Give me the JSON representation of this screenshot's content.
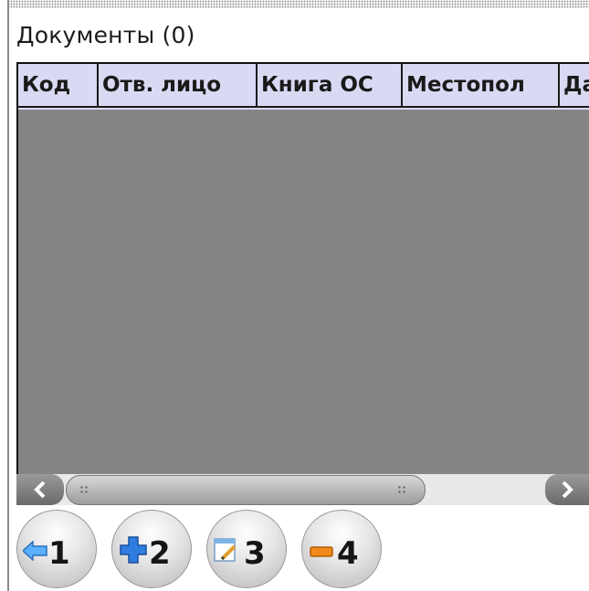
{
  "title": "Документы (0)",
  "table": {
    "columns": [
      "Код",
      "Отв. лицо",
      "Книга ОС",
      "Местопол",
      "Да"
    ],
    "rows": []
  },
  "buttons": [
    {
      "key": "1",
      "icon": "back-arrow-icon"
    },
    {
      "key": "2",
      "icon": "plus-icon"
    },
    {
      "key": "3",
      "icon": "edit-document-icon"
    },
    {
      "key": "4",
      "icon": "minus-icon"
    }
  ],
  "colors": {
    "header_bg": "#d9d9f3",
    "grid_bg": "#868486",
    "arrow_blue": "#5ab0ff",
    "plus_blue": "#2f7de0",
    "minus_orange": "#f08a1c"
  }
}
